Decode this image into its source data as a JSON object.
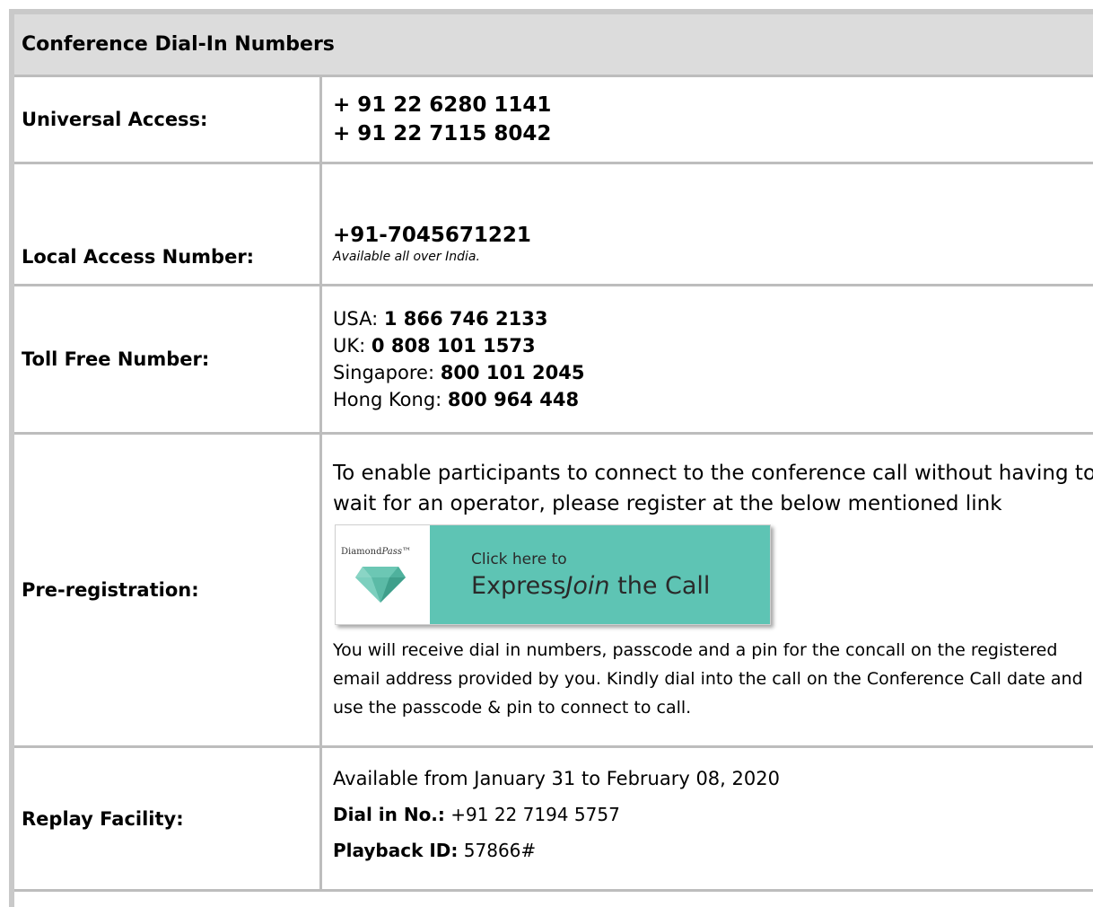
{
  "title": "Conference Dial-In Numbers",
  "universal": {
    "label": "Universal Access:",
    "numbers": [
      "+ 91 22 6280 1141",
      "+ 91 22 7115 8042"
    ]
  },
  "local": {
    "label": "Local Access Number:",
    "number": "+91-7045671221",
    "note": "Available all over India."
  },
  "tollfree": {
    "label": "Toll Free Number:",
    "entries": [
      {
        "country": "USA: ",
        "number": "1 866 746 2133"
      },
      {
        "country": "UK: ",
        "number": "0 808 101 1573"
      },
      {
        "country": "Singapore: ",
        "number": "800 101 2045"
      },
      {
        "country": "Hong Kong: ",
        "number": "800 964 448"
      }
    ]
  },
  "prereg": {
    "label": "Pre-registration:",
    "intro": "To enable participants to connect to the conference call without having to wait for an operator, please register at the below mentioned link",
    "badge": {
      "brand_a": "Diamond",
      "brand_b": "Pass",
      "brand_tm": "™",
      "line1": "Click here to",
      "line2_a": "Express",
      "line2_b": "Join",
      "line2_c": " the Call",
      "accent": "#5ec4b4"
    },
    "info": "You will receive dial in numbers, passcode and a pin for the concall on the registered email address provided by you. Kindly dial into the call on the Conference Call date and use the passcode & pin to connect to call."
  },
  "replay": {
    "label": "Replay Facility:",
    "availability": "Available from January 31 to February 08, 2020",
    "dial_label": "Dial in No.:",
    "dial_value": " +91 22 7194 5757",
    "playback_label": "Playback ID:",
    "playback_value": " 57866#"
  }
}
